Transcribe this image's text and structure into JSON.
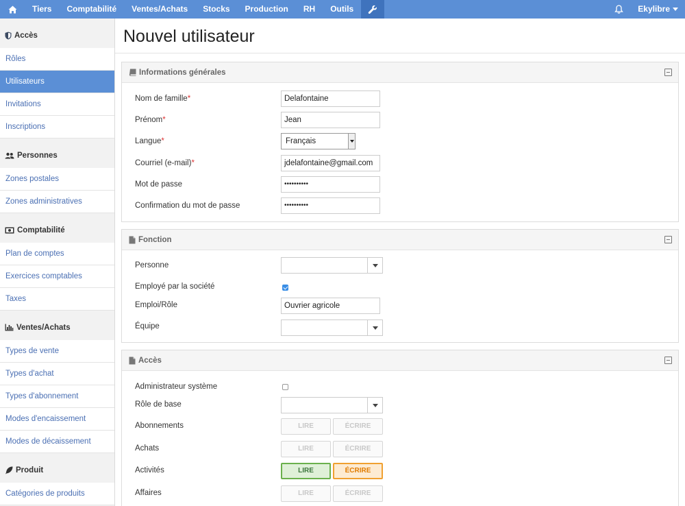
{
  "nav": {
    "items": [
      "Tiers",
      "Comptabilité",
      "Ventes/Achats",
      "Stocks",
      "Production",
      "RH",
      "Outils"
    ],
    "user": "Ekylibre"
  },
  "sidebar": {
    "sections": [
      {
        "title": "Accès",
        "items": [
          "Rôles",
          "Utilisateurs",
          "Invitations",
          "Inscriptions"
        ]
      },
      {
        "title": "Personnes",
        "items": [
          "Zones postales",
          "Zones administratives"
        ]
      },
      {
        "title": "Comptabilité",
        "items": [
          "Plan de comptes",
          "Exercices comptables",
          "Taxes"
        ]
      },
      {
        "title": "Ventes/Achats",
        "items": [
          "Types de vente",
          "Types d'achat",
          "Types d'abonnement",
          "Modes d'encaissement",
          "Modes de décaissement"
        ]
      },
      {
        "title": "Produit",
        "items": [
          "Catégories de produits"
        ]
      }
    ],
    "active": "Utilisateurs"
  },
  "page": {
    "title": "Nouvel utilisateur"
  },
  "general": {
    "title": "Informations générales",
    "last_name_label": "Nom de famille",
    "last_name_value": "Delafontaine",
    "first_name_label": "Prénom",
    "first_name_value": "Jean",
    "language_label": "Langue",
    "language_value": "Français",
    "email_label": "Courriel (e-mail)",
    "email_value": "jdelafontaine@gmail.com",
    "password_label": "Mot de passe",
    "password_value": "••••••••••",
    "confirm_label": "Confirmation du mot de passe",
    "confirm_value": "••••••••••",
    "required_mark": "*"
  },
  "function": {
    "title": "Fonction",
    "person_label": "Personne",
    "employed_label": "Employé par la société",
    "employed_checked": true,
    "role_label": "Emploi/Rôle",
    "role_value": "Ouvrier agricole",
    "team_label": "Équipe"
  },
  "access": {
    "title": "Accès",
    "admin_label": "Administrateur système",
    "admin_checked": false,
    "base_role_label": "Rôle de base",
    "read_label": "LIRE",
    "write_label": "ÉCRIRE",
    "permissions": [
      {
        "name": "Abonnements",
        "read": false,
        "write": false
      },
      {
        "name": "Achats",
        "read": false,
        "write": false
      },
      {
        "name": "Activités",
        "read": true,
        "write": true
      },
      {
        "name": "Affaires",
        "read": false,
        "write": false
      }
    ]
  },
  "colors": {
    "accent": "#5b8fd6",
    "accent_dark": "#3f73bd",
    "link": "#4a6fb3"
  }
}
